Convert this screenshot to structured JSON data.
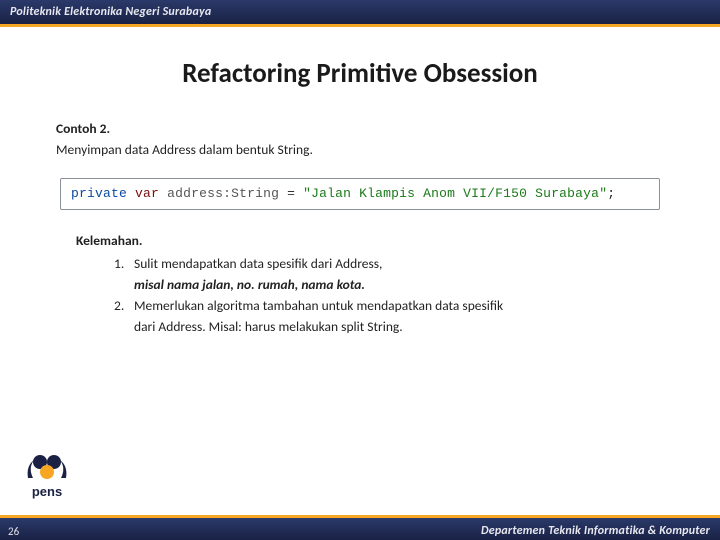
{
  "header": {
    "institution": "Politeknik Elektronika Negeri Surabaya"
  },
  "title": "Refactoring Primitive Obsession",
  "example": {
    "label": "Contoh 2.",
    "description": "Menyimpan data Address dalam bentuk String."
  },
  "code": {
    "kw_private": "private",
    "kw_var": "var",
    "identifier": "address",
    "colon": ":",
    "type": "String",
    "eq": " = ",
    "string": "\"Jalan Klampis Anom VII/F150 Surabaya\"",
    "semi": ";"
  },
  "weakness": {
    "title": "Kelemahan.",
    "items": [
      {
        "n": "1.",
        "text": "Sulit mendapatkan data spesifik dari Address,",
        "cont": "misal nama jalan, no. rumah, nama kota."
      },
      {
        "n": "2.",
        "text": "Memerlukan algoritma tambahan untuk mendapatkan data spesifik",
        "cont2": "dari Address. Misal: harus melakukan split String."
      }
    ]
  },
  "footer": {
    "page": "26",
    "department": "Departemen Teknik Informatika & Komputer",
    "logo_text": "pens"
  }
}
